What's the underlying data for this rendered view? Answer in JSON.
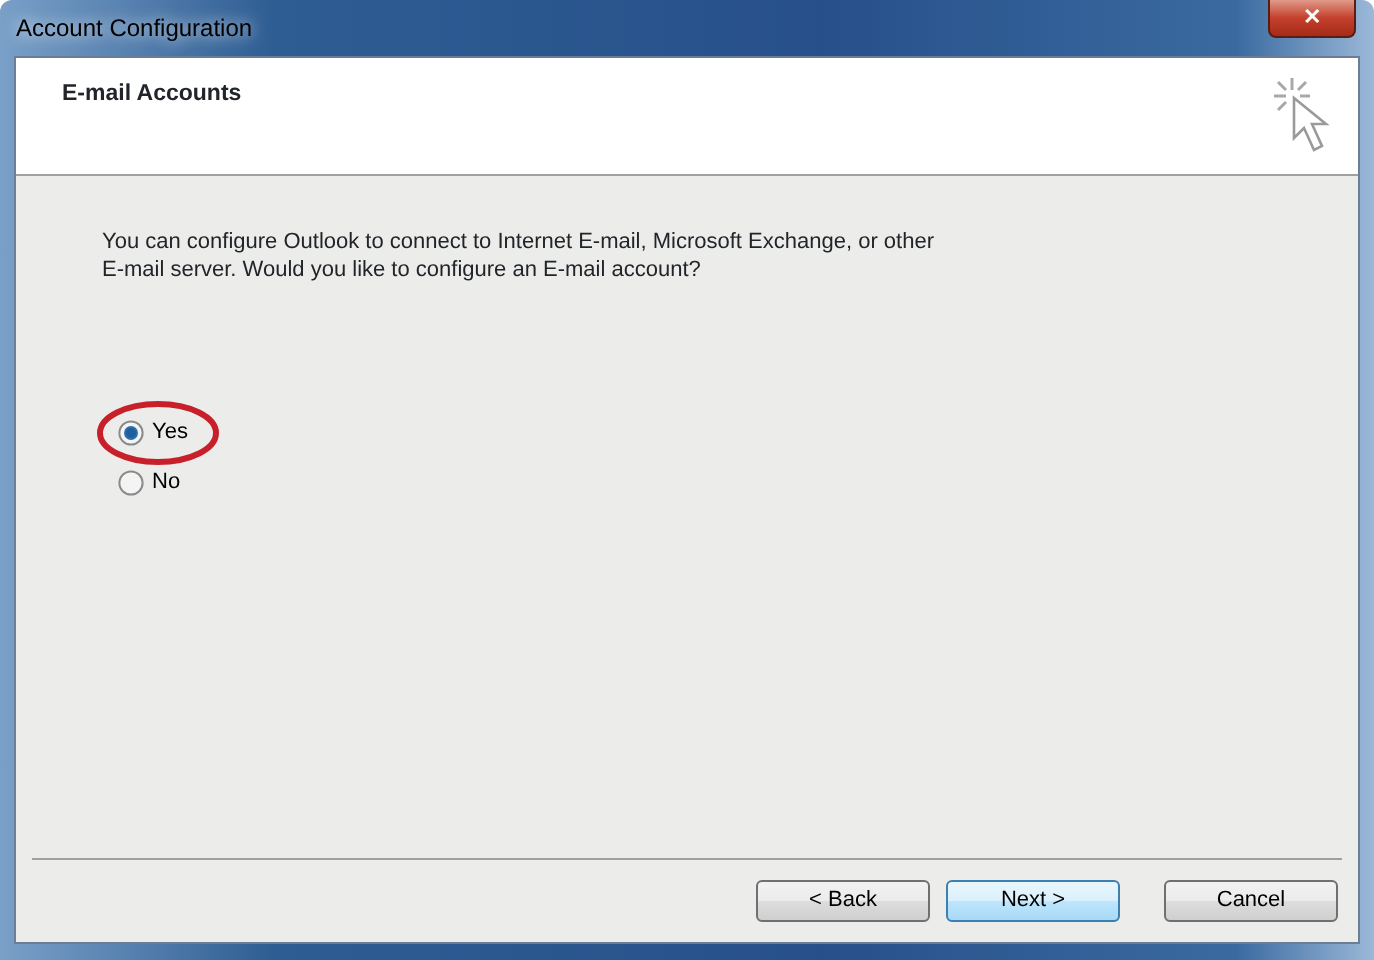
{
  "window": {
    "title": "Account Configuration",
    "close_glyph": "✕"
  },
  "header": {
    "title": "E-mail Accounts"
  },
  "prompt": "You can configure Outlook to connect to Internet E-mail, Microsoft Exchange, or other E-mail server. Would you like to configure an E-mail account?",
  "options": [
    {
      "label": "Yes",
      "selected": true,
      "circled": true
    },
    {
      "label": "No",
      "selected": false,
      "circled": false
    }
  ],
  "buttons": [
    {
      "label": "< Back",
      "default": false
    },
    {
      "label": "Next >",
      "default": true
    },
    {
      "label": "Cancel",
      "default": false
    }
  ]
}
